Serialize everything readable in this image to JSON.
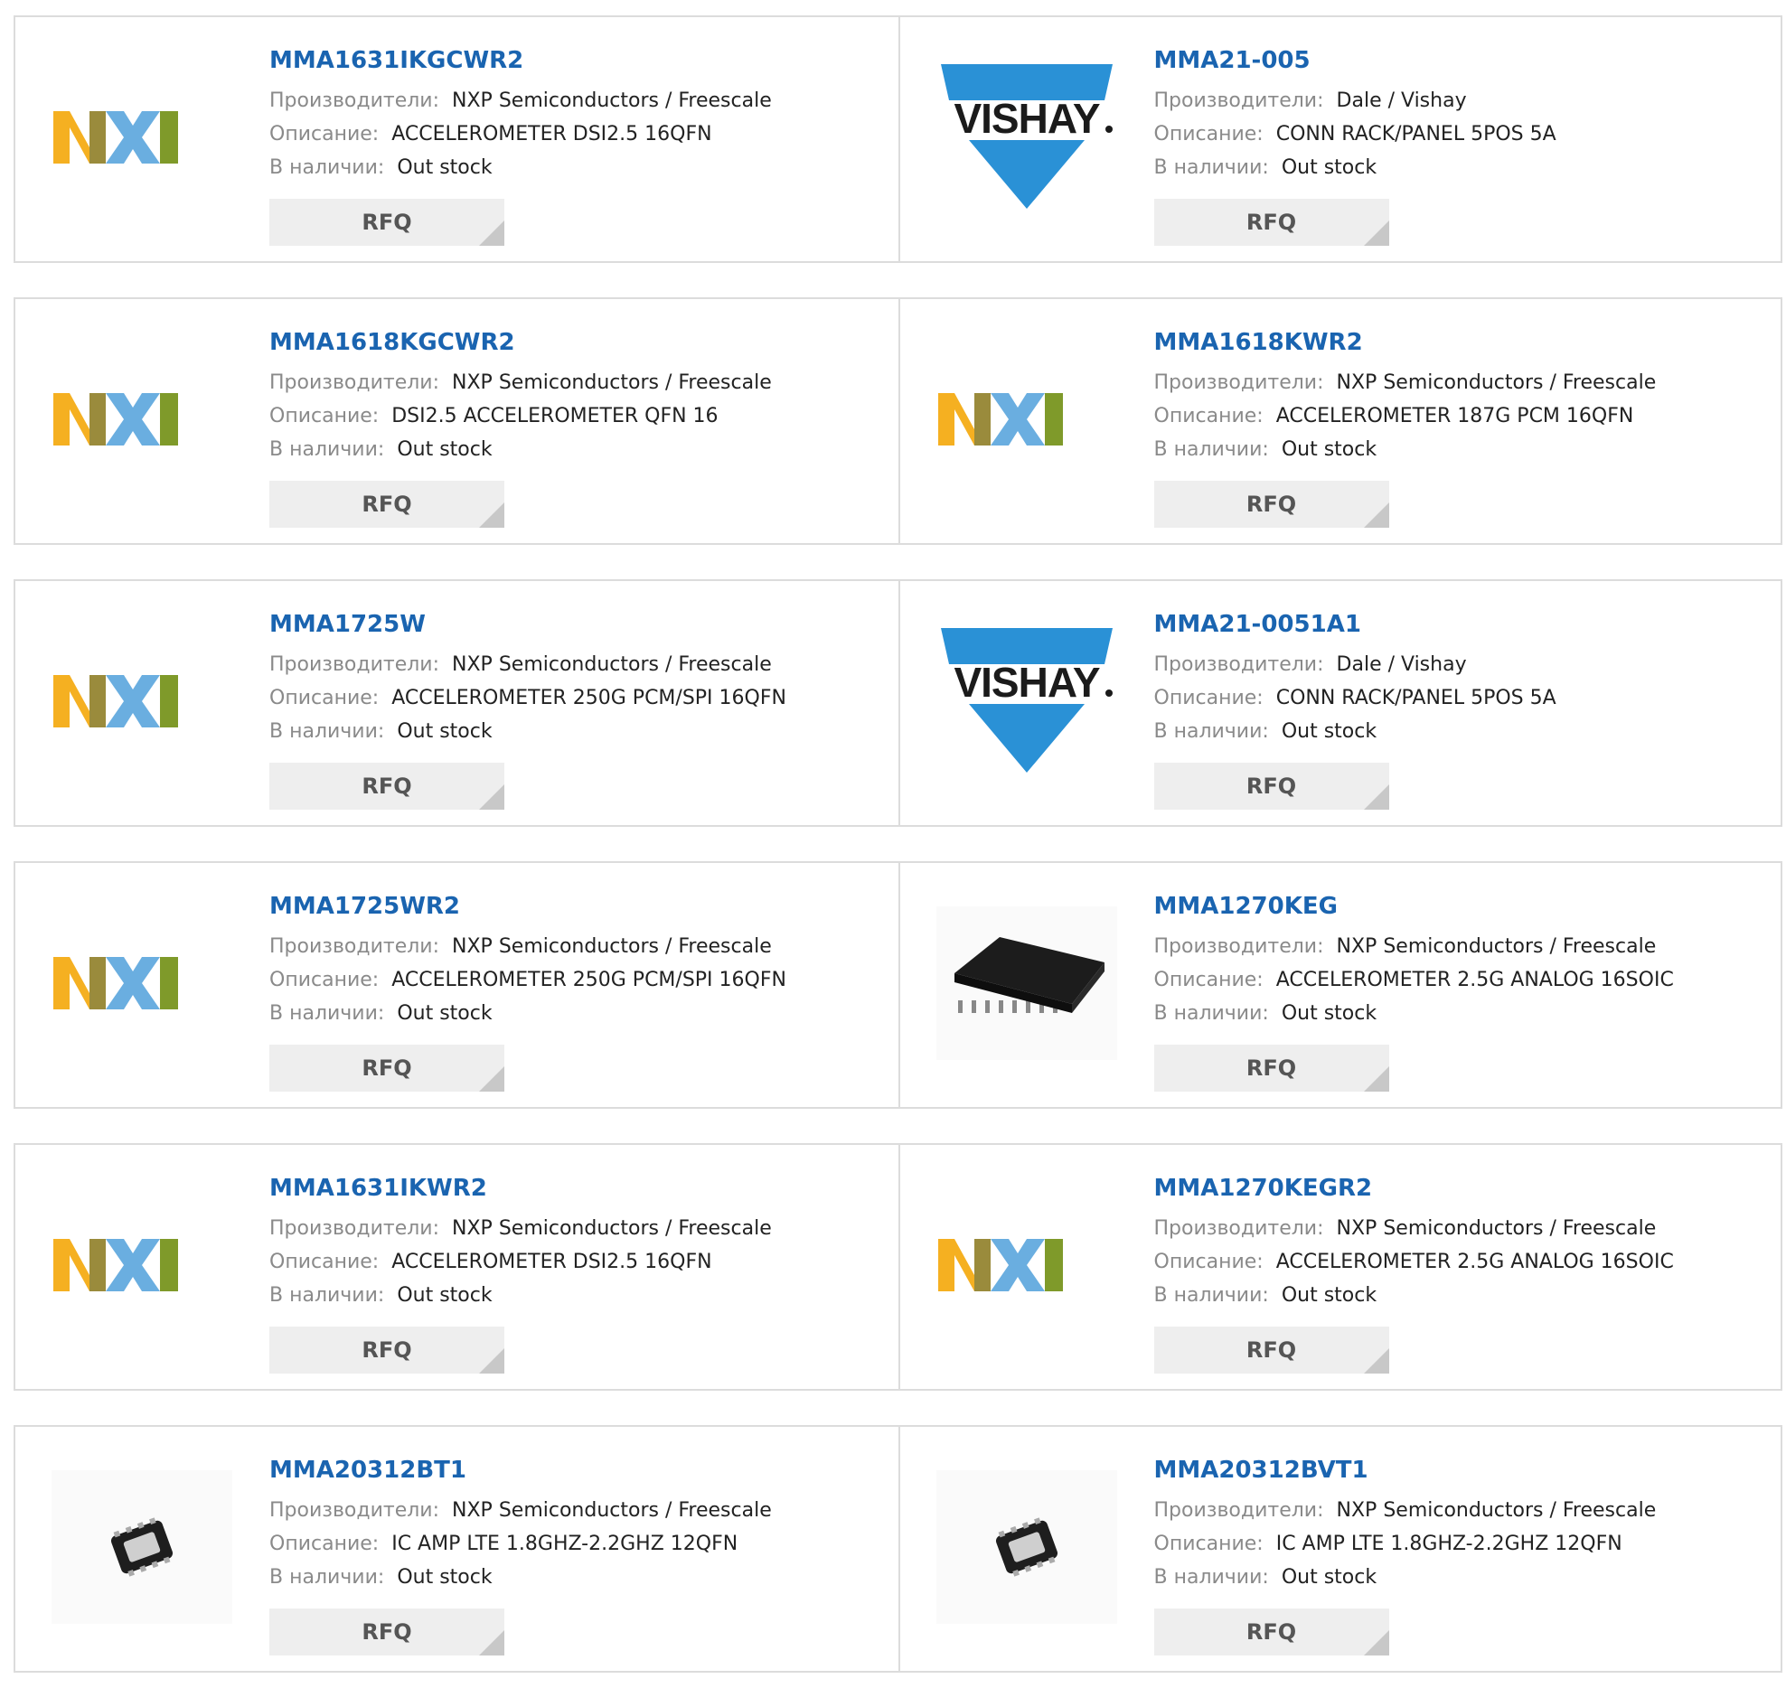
{
  "labels": {
    "manufacturer": "Производители:",
    "description": "Описание:",
    "stock": "В наличии:",
    "rfq": "RFQ"
  },
  "colors": {
    "part_link": "#1a64b0",
    "nxp_orange": "#f5b021",
    "nxp_blue": "#6aaee0",
    "nxp_green": "#b8d432",
    "vishay_blue": "#2a91d6"
  },
  "rows": [
    [
      {
        "part": "MMA1631IKGCWR2",
        "manufacturer": "NXP Semiconductors / Freescale",
        "description": "ACCELEROMETER DSI2.5 16QFN",
        "stock": "Out stock",
        "image": "nxp-logo"
      },
      {
        "part": "MMA21-005",
        "manufacturer": "Dale / Vishay",
        "description": "CONN RACK/PANEL 5POS 5A",
        "stock": "Out stock",
        "image": "vishay-logo"
      }
    ],
    [
      {
        "part": "MMA1618KGCWR2",
        "manufacturer": "NXP Semiconductors / Freescale",
        "description": "DSI2.5 ACCELEROMETER QFN 16",
        "stock": "Out stock",
        "image": "nxp-logo"
      },
      {
        "part": "MMA1618KWR2",
        "manufacturer": "NXP Semiconductors / Freescale",
        "description": "ACCELEROMETER 187G PCM 16QFN",
        "stock": "Out stock",
        "image": "nxp-logo"
      }
    ],
    [
      {
        "part": "MMA1725W",
        "manufacturer": "NXP Semiconductors / Freescale",
        "description": "ACCELEROMETER 250G PCM/SPI 16QFN",
        "stock": "Out stock",
        "image": "nxp-logo"
      },
      {
        "part": "MMA21-0051A1",
        "manufacturer": "Dale / Vishay",
        "description": "CONN RACK/PANEL 5POS 5A",
        "stock": "Out stock",
        "image": "vishay-logo"
      }
    ],
    [
      {
        "part": "MMA1725WR2",
        "manufacturer": "NXP Semiconductors / Freescale",
        "description": "ACCELEROMETER 250G PCM/SPI 16QFN",
        "stock": "Out stock",
        "image": "nxp-logo"
      },
      {
        "part": "MMA1270KEG",
        "manufacturer": "NXP Semiconductors / Freescale",
        "description": "ACCELEROMETER 2.5G ANALOG 16SOIC",
        "stock": "Out stock",
        "image": "soic-chip"
      }
    ],
    [
      {
        "part": "MMA1631IKWR2",
        "manufacturer": "NXP Semiconductors / Freescale",
        "description": "ACCELEROMETER DSI2.5 16QFN",
        "stock": "Out stock",
        "image": "nxp-logo"
      },
      {
        "part": "MMA1270KEGR2",
        "manufacturer": "NXP Semiconductors / Freescale",
        "description": "ACCELEROMETER 2.5G ANALOG 16SOIC",
        "stock": "Out stock",
        "image": "nxp-logo"
      }
    ],
    [
      {
        "part": "MMA20312BT1",
        "manufacturer": "NXP Semiconductors / Freescale",
        "description": "IC AMP LTE 1.8GHZ-2.2GHZ 12QFN",
        "stock": "Out stock",
        "image": "qfn-chip"
      },
      {
        "part": "MMA20312BVT1",
        "manufacturer": "NXP Semiconductors / Freescale",
        "description": "IC AMP LTE 1.8GHZ-2.2GHZ 12QFN",
        "stock": "Out stock",
        "image": "qfn-chip"
      }
    ]
  ]
}
